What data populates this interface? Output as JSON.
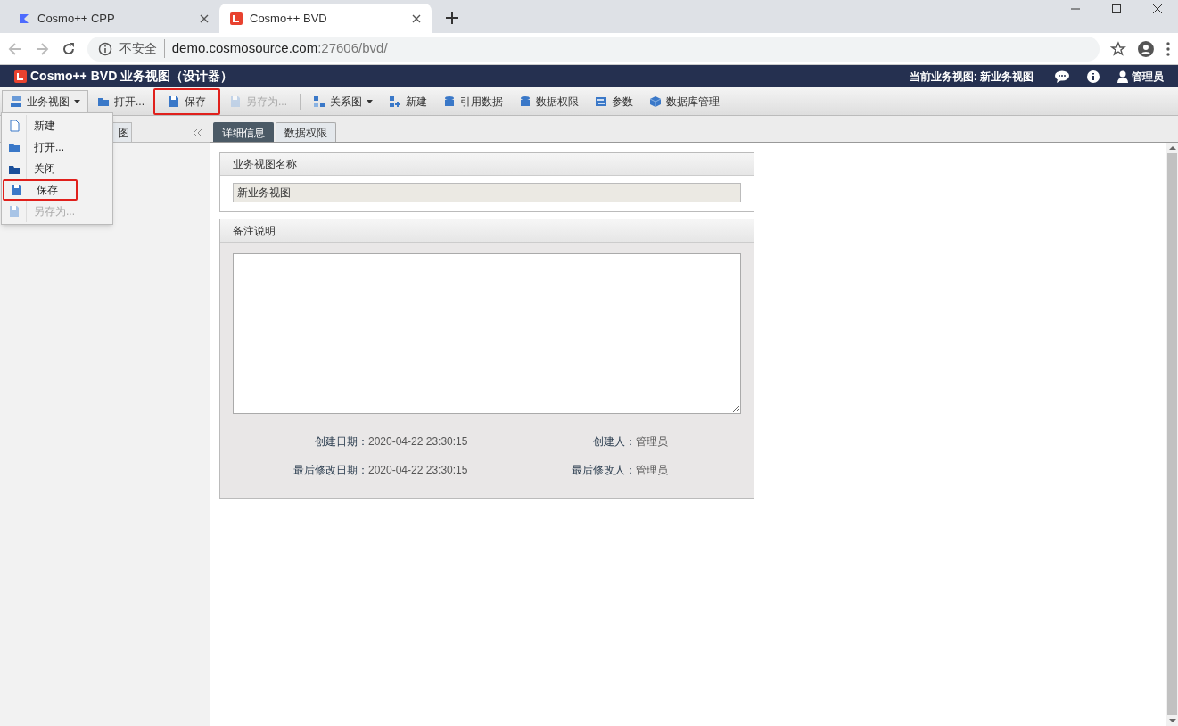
{
  "browser": {
    "tabs": [
      {
        "title": "Cosmo++ CPP",
        "selected": false
      },
      {
        "title": "Cosmo++ BVD",
        "selected": true
      }
    ],
    "security": "不安全",
    "url_host": "demo.cosmosource.com",
    "url_rest": ":27606/bvd/"
  },
  "app": {
    "title": "Cosmo++ BVD 业务视图（设计器）",
    "current_view": "当前业务视图: 新业务视图",
    "user": "管理员"
  },
  "toolbar": [
    {
      "label": "业务视图",
      "kind": "dropdown",
      "disabled": false,
      "highlighted": false
    },
    {
      "label": "打开...",
      "kind": "button",
      "disabled": false,
      "highlighted": false
    },
    {
      "label": "保存",
      "kind": "button",
      "disabled": false,
      "highlighted": true
    },
    {
      "label": "另存为...",
      "kind": "button",
      "disabled": true,
      "highlighted": false
    },
    {
      "label": "关系图",
      "kind": "dropdown",
      "disabled": false,
      "highlighted": false
    },
    {
      "label": "新建",
      "kind": "button",
      "disabled": false,
      "highlighted": false
    },
    {
      "label": "引用数据",
      "kind": "button",
      "disabled": false,
      "highlighted": false
    },
    {
      "label": "数据权限",
      "kind": "button",
      "disabled": false,
      "highlighted": false
    },
    {
      "label": "参数",
      "kind": "button",
      "disabled": false,
      "highlighted": false
    },
    {
      "label": "数据库管理",
      "kind": "button",
      "disabled": false,
      "highlighted": false
    }
  ],
  "menu": [
    {
      "label": "新建",
      "disabled": false,
      "highlighted": false
    },
    {
      "label": "打开...",
      "disabled": false,
      "highlighted": false
    },
    {
      "label": "关闭",
      "disabled": false,
      "highlighted": false
    },
    {
      "label": "保存",
      "disabled": false,
      "highlighted": true
    },
    {
      "label": "另存为...",
      "disabled": true,
      "highlighted": false
    }
  ],
  "left_panel": {
    "tab": "图"
  },
  "content_tabs": [
    {
      "label": "详细信息",
      "selected": true
    },
    {
      "label": "数据权限",
      "selected": false
    }
  ],
  "name_section": {
    "title": "业务视图名称",
    "value": "新业务视图"
  },
  "notes_section": {
    "title": "备注说明",
    "meta": [
      {
        "label": "创建日期：",
        "value": "2020-04-22 23:30:15"
      },
      {
        "label": "创建人：",
        "value": "管理员"
      },
      {
        "label": "最后修改日期：",
        "value": "2020-04-22 23:30:15"
      },
      {
        "label": "最后修改人：",
        "value": "管理员"
      }
    ]
  }
}
